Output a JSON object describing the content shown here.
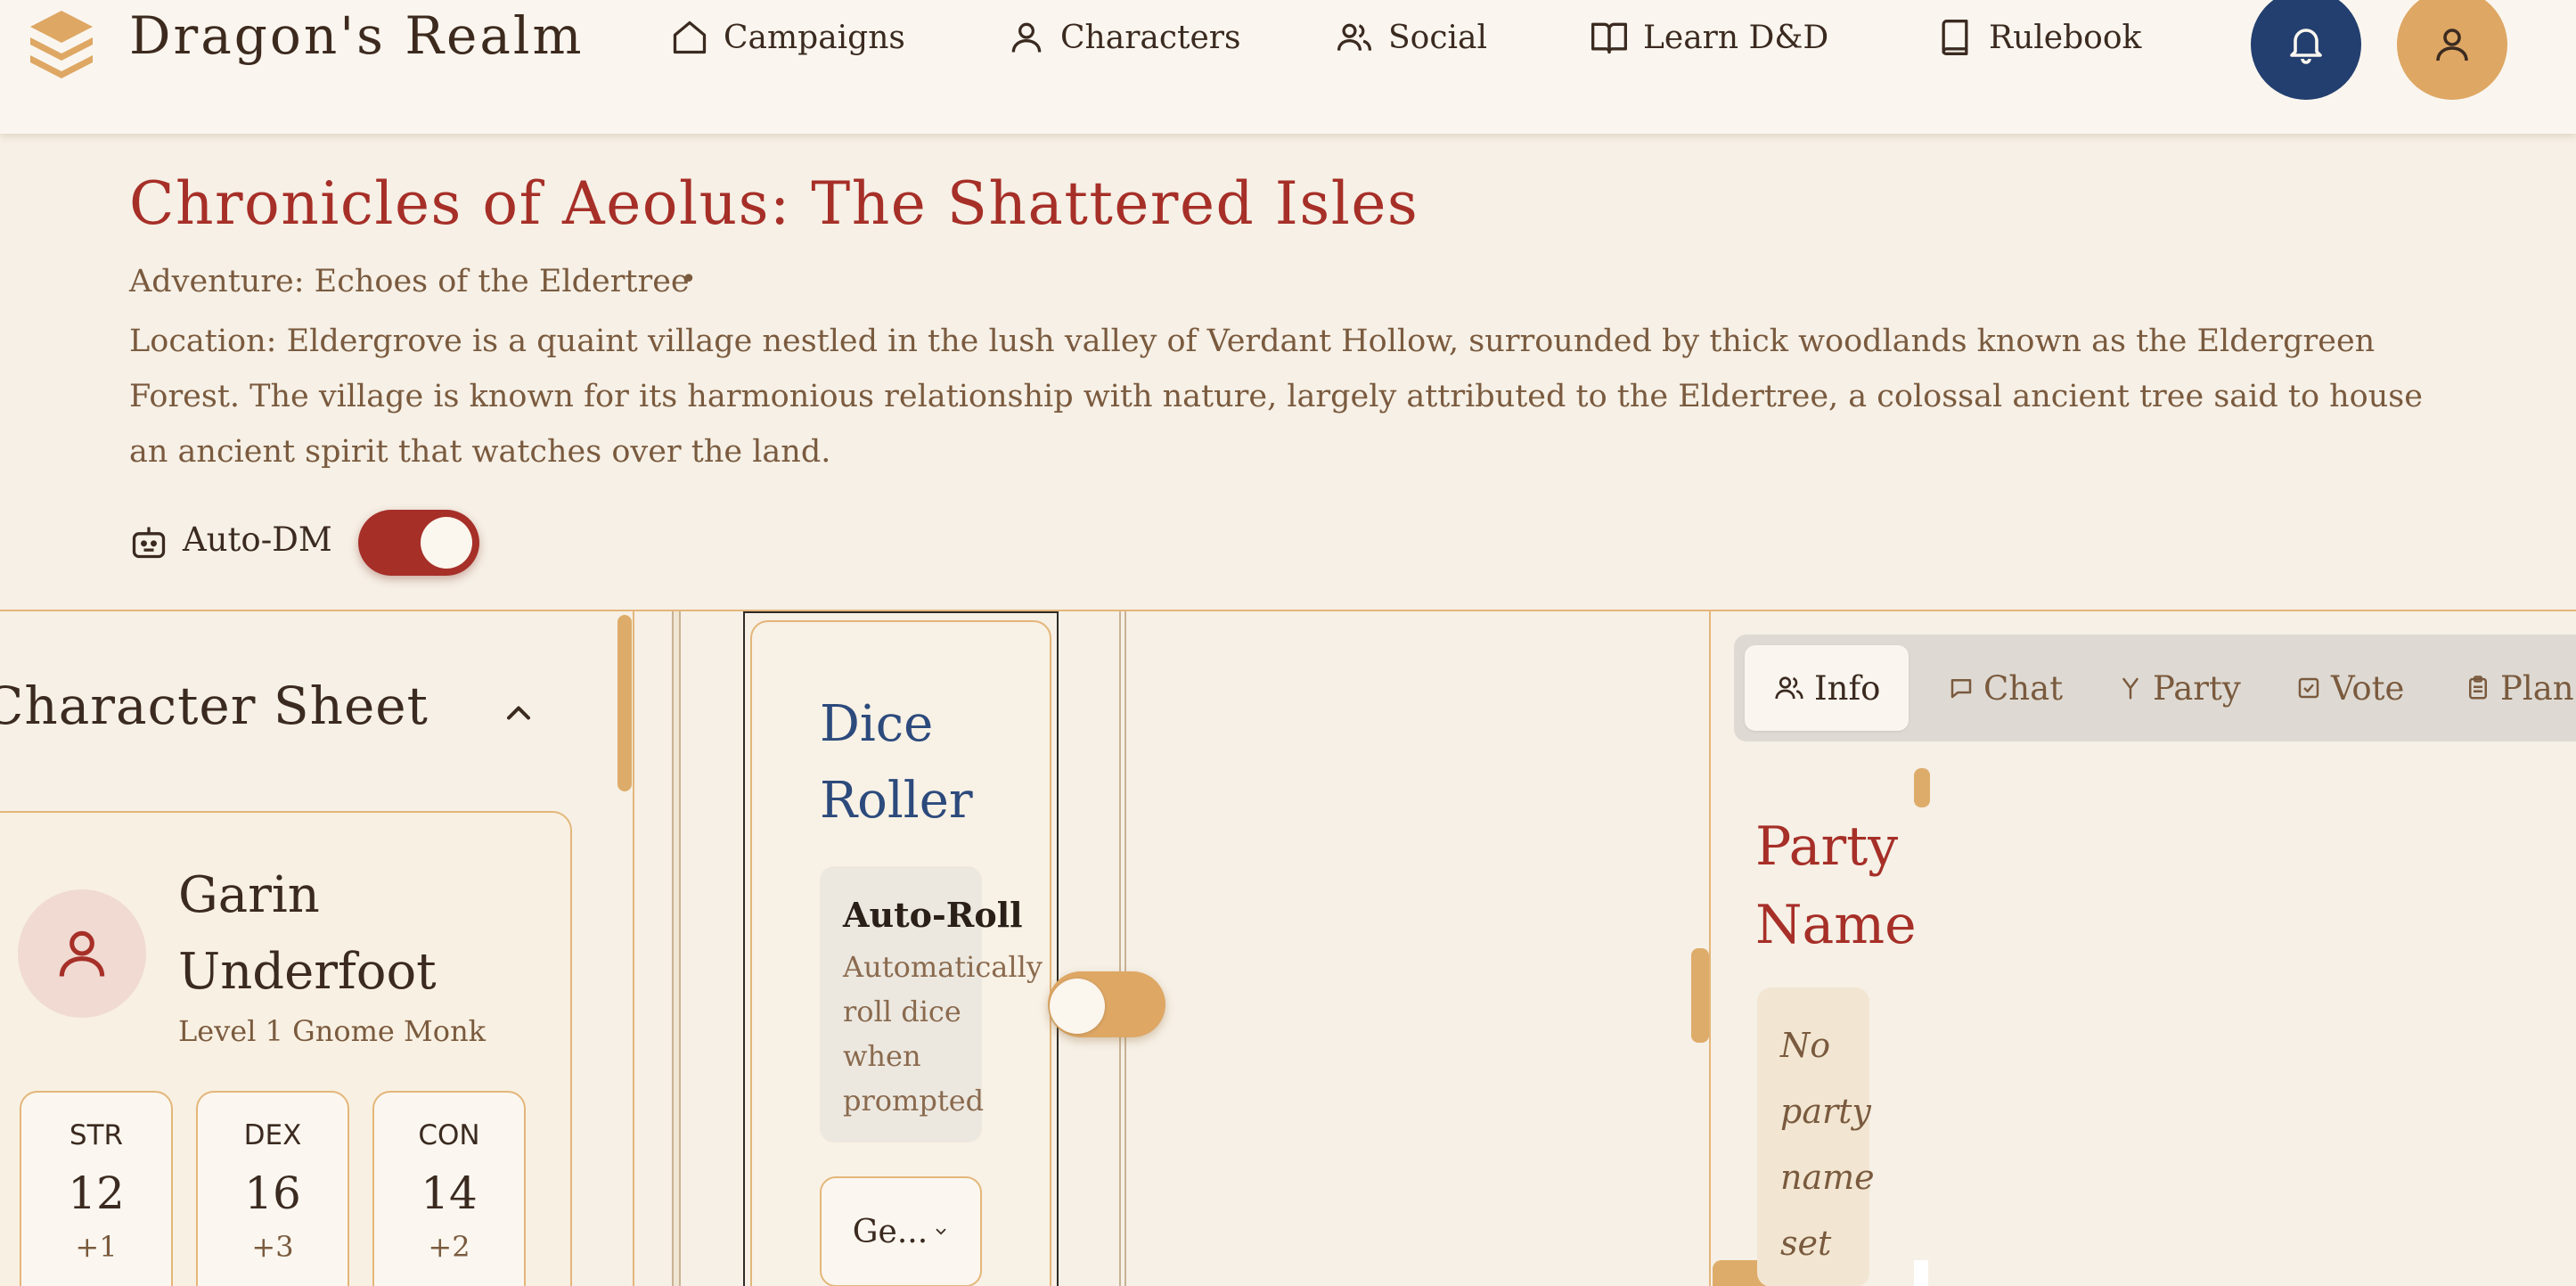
{
  "header": {
    "brand": "Dragon's Realm",
    "nav": [
      {
        "label": "Campaigns",
        "icon": "home-icon"
      },
      {
        "label": "Characters",
        "icon": "user-icon"
      },
      {
        "label": "Social",
        "icon": "users-icon"
      },
      {
        "label": "Learn D&D",
        "icon": "book-open-icon"
      },
      {
        "label": "Rulebook",
        "icon": "book-icon"
      }
    ],
    "notification_icon": "bell-icon",
    "profile_icon": "user-icon"
  },
  "campaign": {
    "title": "Chronicles of Aeolus: The Shattered Isles",
    "adventure": "Adventure: Echoes of the Eldertree",
    "separator": "•",
    "location": "Location: Eldergrove is a quaint village nestled in the lush valley of Verdant Hollow, surrounded by thick woodlands known as the Eldergreen Forest. The village is known for its harmonious relationship with nature, largely attributed to the Eldertree, a colossal ancient tree said to house an ancient spirit that watches over the land.",
    "auto_dm_label": "Auto-DM",
    "auto_dm_on": true
  },
  "character_sheet": {
    "title": "Character Sheet",
    "name": "Garin Underfoot",
    "class_line": "Level 1 Gnome Monk",
    "stats": [
      {
        "abbr": "STR",
        "value": "12",
        "mod": "+1"
      },
      {
        "abbr": "DEX",
        "value": "16",
        "mod": "+3"
      },
      {
        "abbr": "CON",
        "value": "14",
        "mod": "+2"
      }
    ]
  },
  "dice_roller": {
    "title": "Dice Roller",
    "auto_roll_title": "Auto-Roll",
    "auto_roll_desc": "Automatically roll dice when prompted",
    "auto_roll_on": false,
    "select_value": "Ge..."
  },
  "side_panel": {
    "tabs": [
      {
        "label": "Info",
        "icon": "users-icon",
        "active": true
      },
      {
        "label": "Chat",
        "icon": "chat-icon"
      },
      {
        "label": "Party",
        "icon": "party-icon"
      },
      {
        "label": "Vote",
        "icon": "vote-icon"
      },
      {
        "label": "Plan",
        "icon": "clipboard-icon"
      }
    ],
    "party_name_heading": "Party Name",
    "party_name_empty": "No party name set"
  },
  "colors": {
    "accent_red": "#a62f28",
    "accent_gold": "#dea764",
    "accent_blue": "#2c4a7c",
    "background": "#f6f0e6"
  }
}
